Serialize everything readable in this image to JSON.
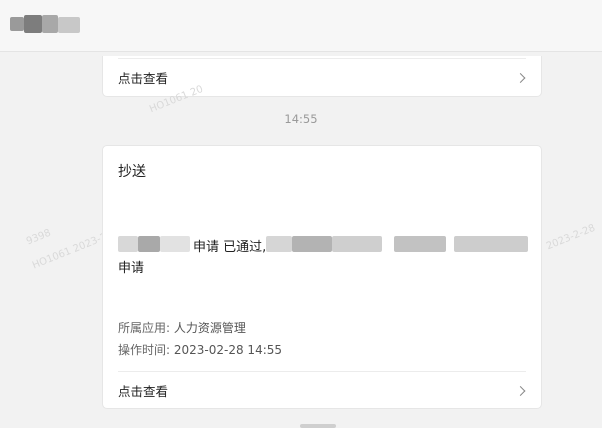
{
  "top_card": {
    "view_label": "点击查看"
  },
  "separators": {
    "first_time": "14:55"
  },
  "main_card": {
    "title": "抄送",
    "message_word1": "申请",
    "message_word2": "已通过,",
    "message_line2": "申请",
    "app_label": "所属应用:",
    "app_value": "人力资源管理",
    "time_label": "操作时间:",
    "time_value": "2023-02-28 14:55",
    "view_label": "点击查看"
  },
  "watermark": {
    "text1": "HO1061 20",
    "text2": "9398",
    "text3": "HO1061 2023-2",
    "text4": "2023-2-28"
  },
  "colors": {
    "background": "#f2f2f2",
    "card": "#ffffff",
    "text": "#222222",
    "muted": "#666666",
    "separator_time": "#9a9a9a"
  },
  "icons": {
    "view_chevron": "chevron-right-icon"
  }
}
